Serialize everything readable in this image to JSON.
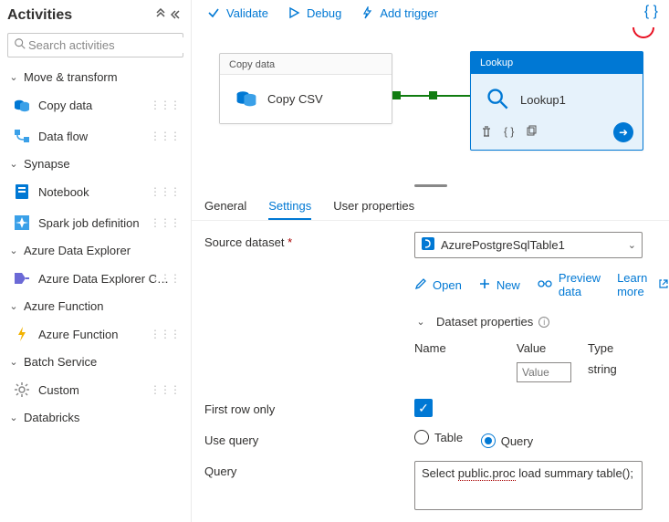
{
  "sidebar": {
    "title": "Activities",
    "search_placeholder": "Search activities",
    "groups": [
      {
        "label": "Move & transform",
        "items": [
          {
            "label": "Copy data",
            "icon": "copy-data"
          },
          {
            "label": "Data flow",
            "icon": "data-flow"
          }
        ]
      },
      {
        "label": "Synapse",
        "items": [
          {
            "label": "Notebook",
            "icon": "notebook"
          },
          {
            "label": "Spark job definition",
            "icon": "spark-job"
          }
        ]
      },
      {
        "label": "Azure Data Explorer",
        "items": [
          {
            "label": "Azure Data Explorer C…",
            "icon": "adx"
          }
        ]
      },
      {
        "label": "Azure Function",
        "items": [
          {
            "label": "Azure Function",
            "icon": "function"
          }
        ]
      },
      {
        "label": "Batch Service",
        "items": [
          {
            "label": "Custom",
            "icon": "custom"
          }
        ]
      },
      {
        "label": "Databricks",
        "items": []
      }
    ]
  },
  "toolbar": {
    "validate": "Validate",
    "debug": "Debug",
    "add_trigger": "Add trigger"
  },
  "canvas": {
    "copy_node": {
      "type_label": "Copy data",
      "name": "Copy CSV"
    },
    "lookup_node": {
      "type_label": "Lookup",
      "name": "Lookup1"
    }
  },
  "tabs": [
    {
      "label": "General"
    },
    {
      "label": "Settings",
      "active": true
    },
    {
      "label": "User properties"
    }
  ],
  "settings": {
    "source_dataset_label": "Source dataset",
    "dataset_value": "AzurePostgreSqlTable1",
    "actions": {
      "open": "Open",
      "new": "New",
      "preview": "Preview data",
      "learn_more": "Learn more"
    },
    "dataset_props": {
      "header": "Dataset properties",
      "name_col": "Name",
      "value_col": "Value",
      "type_col": "Type",
      "row_value_placeholder": "Value",
      "row_type": "string"
    },
    "first_row_label": "First row only",
    "first_row_checked": true,
    "use_query_label": "Use query",
    "use_query_options": {
      "table": "Table",
      "query": "Query"
    },
    "use_query_selected": "query",
    "query_label": "Query",
    "query_value_parts": [
      "Select ",
      "public.proc",
      " load summary table();"
    ]
  }
}
